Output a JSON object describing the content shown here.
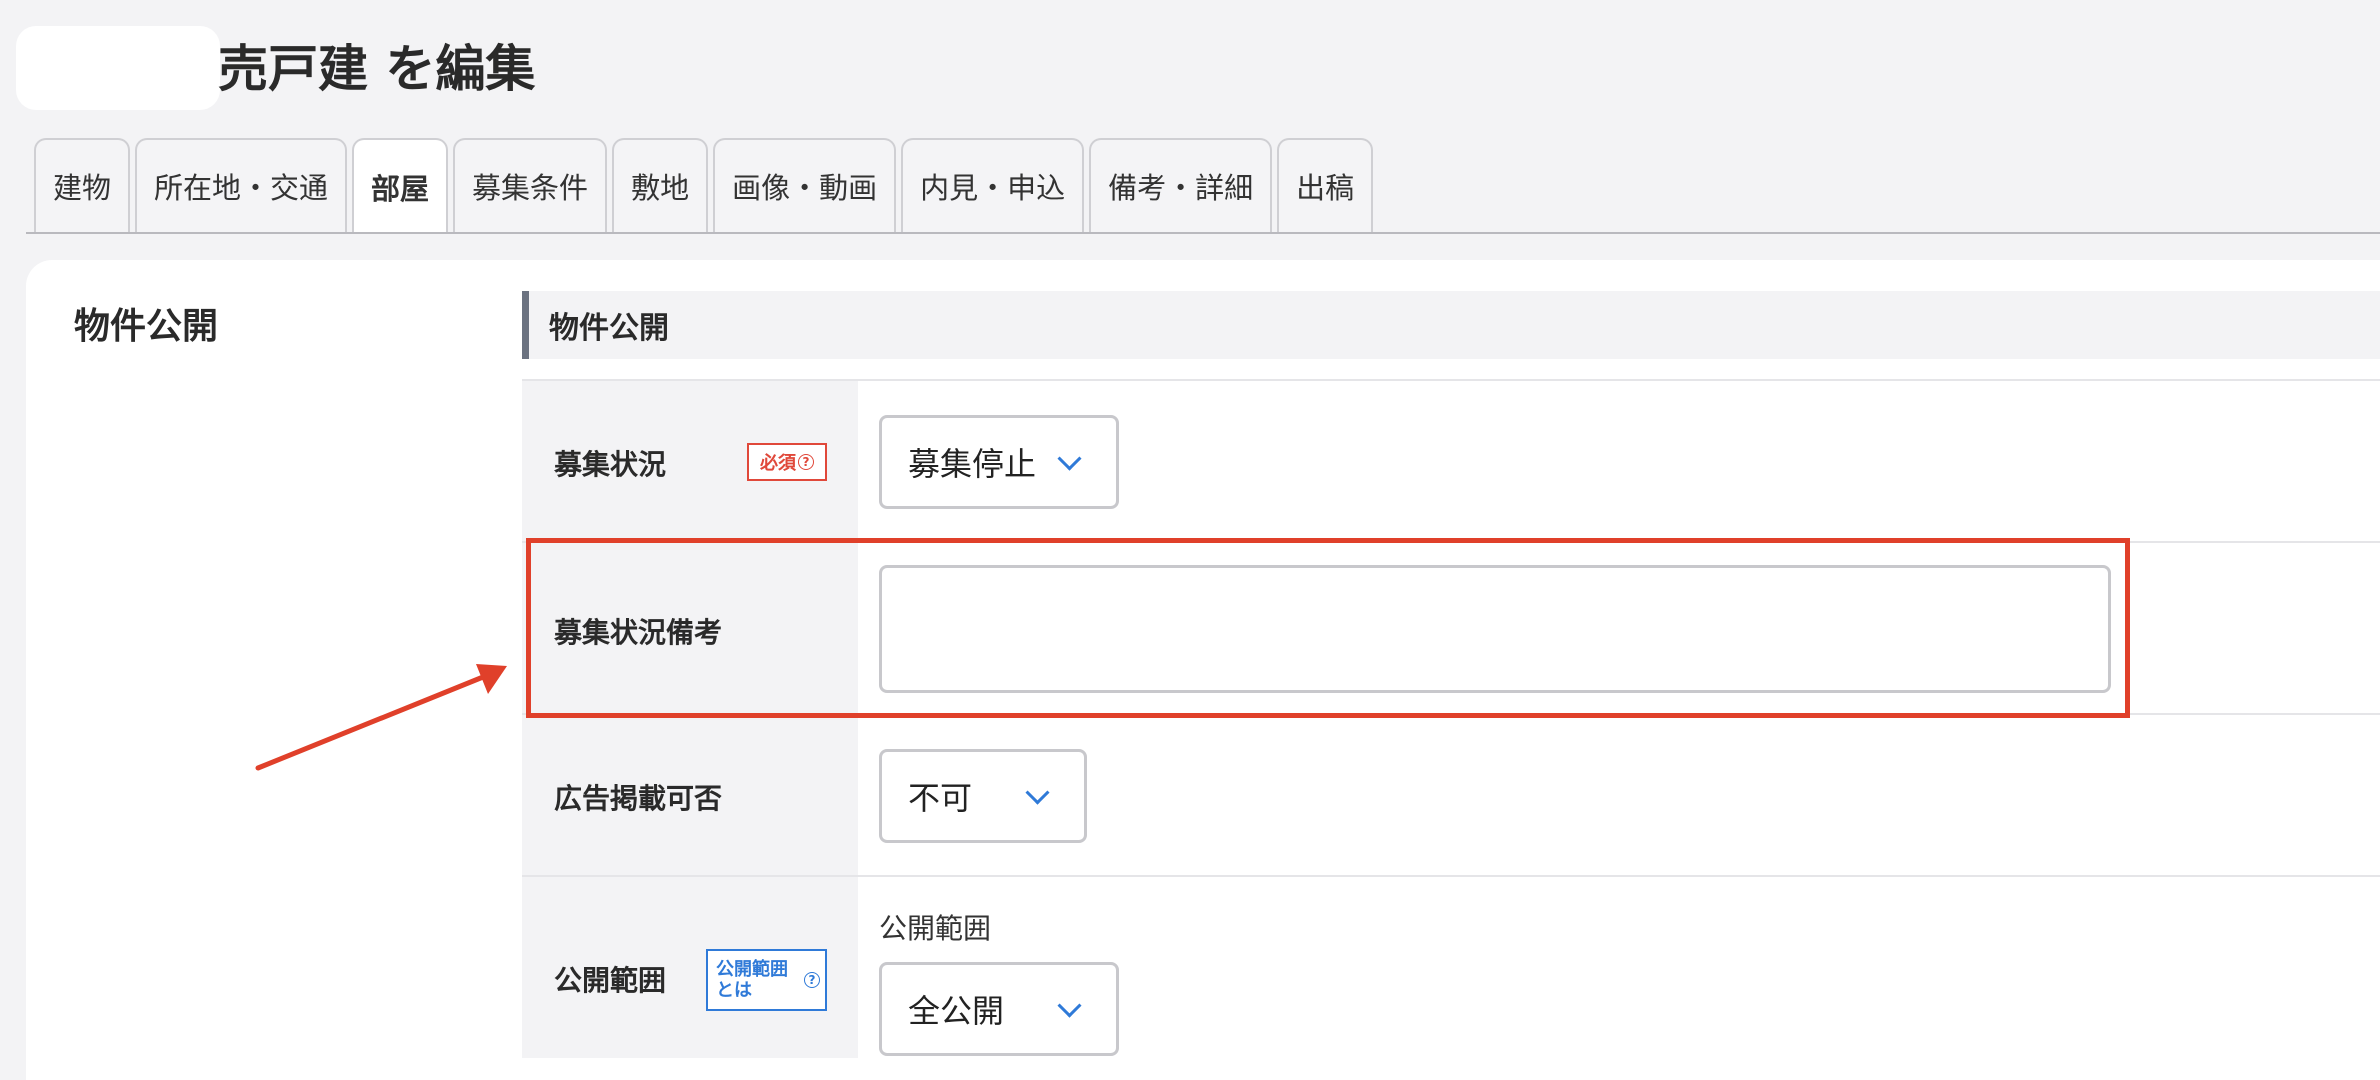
{
  "page": {
    "title": "売戸建 を編集"
  },
  "tabs": [
    {
      "label": "建物",
      "active": false
    },
    {
      "label": "所在地・交通",
      "active": false
    },
    {
      "label": "部屋",
      "active": true
    },
    {
      "label": "募集条件",
      "active": false
    },
    {
      "label": "敷地",
      "active": false
    },
    {
      "label": "画像・動画",
      "active": false
    },
    {
      "label": "内見・申込",
      "active": false
    },
    {
      "label": "備考・詳細",
      "active": false
    },
    {
      "label": "出稿",
      "active": false
    }
  ],
  "panel": {
    "heading": "物件公開",
    "section_title": "物件公開",
    "fields": {
      "status": {
        "label": "募集状況",
        "badge": "必須",
        "value": "募集停止"
      },
      "status_note": {
        "label": "募集状況備考",
        "value": ""
      },
      "ad_permission": {
        "label": "広告掲載可否",
        "value": "不可"
      },
      "visibility": {
        "label": "公開範囲",
        "badge_line1": "公開範囲",
        "badge_line2": "とは",
        "sub_label": "公開範囲",
        "value": "全公開"
      }
    }
  },
  "colors": {
    "highlight": "#e0402a",
    "required": "#e0483a",
    "info": "#2f7ad8",
    "section_bar": "#6b7280"
  },
  "icons": {
    "help": "question-circle-icon",
    "dropdown": "chevron-down-icon"
  }
}
